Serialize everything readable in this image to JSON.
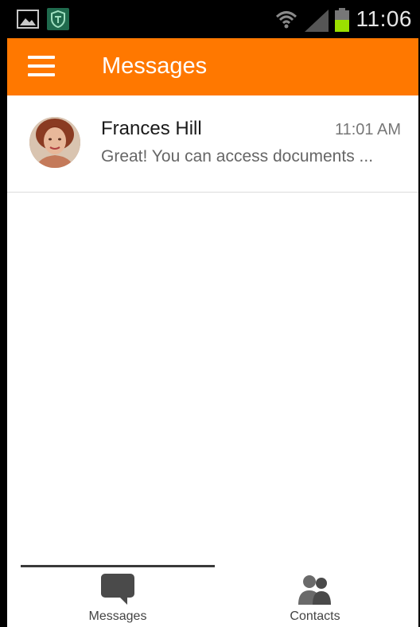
{
  "status_bar": {
    "time": "11:06",
    "icons": [
      "gallery-icon",
      "shield-icon",
      "wifi-icon",
      "signal-icon",
      "battery-icon"
    ]
  },
  "header": {
    "title": "Messages",
    "menu_icon": "hamburger-menu-icon"
  },
  "conversations": [
    {
      "name": "Frances Hill",
      "time": "11:01 AM",
      "preview": "Great! You can access documents ..."
    }
  ],
  "bottom_nav": {
    "tabs": [
      {
        "label": "Messages",
        "icon": "chat-bubble-icon",
        "active": true
      },
      {
        "label": "Contacts",
        "icon": "contacts-icon",
        "active": false
      }
    ]
  },
  "colors": {
    "accent": "#ff7800",
    "status_bar": "#000000",
    "tab_icon": "#4a4a4a"
  }
}
